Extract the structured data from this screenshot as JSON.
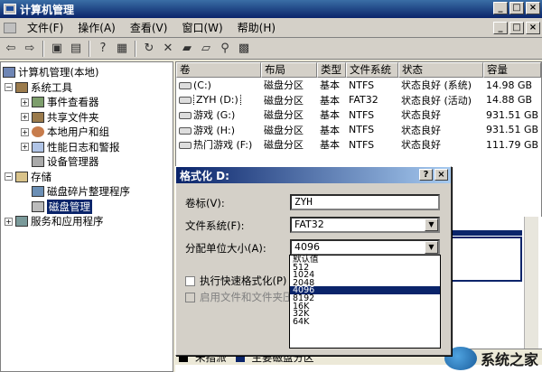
{
  "window": {
    "title": "计算机管理",
    "controls": [
      "_",
      "□",
      "×"
    ],
    "inner_controls": [
      "_",
      "□",
      "×"
    ]
  },
  "menu": [
    "文件(F)",
    "操作(A)",
    "查看(V)",
    "窗口(W)",
    "帮助(H)"
  ],
  "toolbar_icons": [
    "back-arrow-icon",
    "forward-arrow-icon",
    "up-folder-icon",
    "show-tree-icon",
    "help-icon",
    "properties-icon",
    "refresh-icon",
    "delete-icon",
    "open-folder-icon",
    "new-folder-icon",
    "search-icon",
    "export-icon"
  ],
  "tree": {
    "root": "计算机管理(本地)",
    "system_tools": "系统工具",
    "event_viewer": "事件查看器",
    "shared_folders": "共享文件夹",
    "local_users": "本地用户和组",
    "perf_logs": "性能日志和警报",
    "device_manager": "设备管理器",
    "storage": "存储",
    "defrag": "磁盘碎片整理程序",
    "disk_mgmt": "磁盘管理",
    "services": "服务和应用程序"
  },
  "table": {
    "headers": [
      "卷",
      "布局",
      "类型",
      "文件系统",
      "状态",
      "容量"
    ],
    "rows": [
      [
        "(C:)",
        "磁盘分区",
        "基本",
        "NTFS",
        "状态良好 (系统)",
        "14.98 GB"
      ],
      [
        "ZYH (D:)",
        "磁盘分区",
        "基本",
        "FAT32",
        "状态良好 (活动)",
        "14.88 GB"
      ],
      [
        "游戏 (G:)",
        "磁盘分区",
        "基本",
        "NTFS",
        "状态良好",
        "931.51 GB"
      ],
      [
        "游戏 (H:)",
        "磁盘分区",
        "基本",
        "NTFS",
        "状态良好",
        "931.51 GB"
      ],
      [
        "热门游戏 (F:)",
        "磁盘分区",
        "基本",
        "NTFS",
        "状态良好",
        "111.79 GB"
      ]
    ]
  },
  "legend": {
    "unallocated": "未指派",
    "primary": "主要磁盘分区",
    "unallocated_color": "#000000",
    "primary_color": "#0a246a"
  },
  "dialog": {
    "title": "格式化 D:",
    "help_btn": "?",
    "close_btn": "×",
    "volume_label_label": "卷标(V):",
    "volume_label_value": "ZYH",
    "filesystem_label": "文件系统(F):",
    "filesystem_value": "FAT32",
    "alloc_label": "分配单位大小(A):",
    "alloc_value": "4096",
    "quick_format_label": "执行快速格式化(P)",
    "compression_label": "启用文件和文件夹压"
  },
  "dropdown_options": [
    "默认值",
    "512",
    "1024",
    "2048",
    "4096",
    "8192",
    "16K",
    "32K",
    "64K"
  ],
  "dropdown_selected": "4096",
  "watermark": "系统之家"
}
